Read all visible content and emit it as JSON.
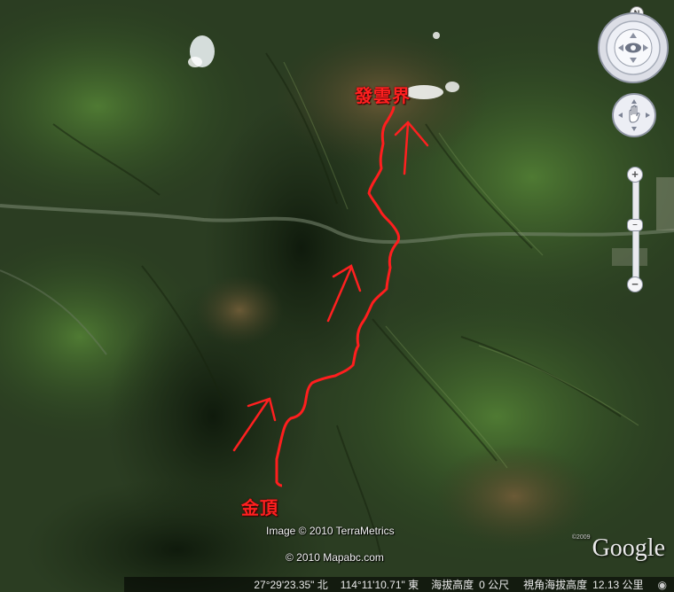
{
  "map": {
    "labels": {
      "summit_north": "發雲界",
      "summit_south": "金頂"
    },
    "credits": {
      "imagery": "Image © 2010 TerraMetrics",
      "data": "© 2010 Mapabc.com"
    },
    "logo": {
      "text": "Google",
      "year": "©2009"
    },
    "route_color": "#ff2020"
  },
  "statusbar": {
    "latitude": "27°29'23.35\" 北",
    "longitude": "114°11'10.71\" 東",
    "elevation_label": "海拔高度",
    "elevation_value": "0 公尺",
    "eye_alt_label": "視角海拔高度",
    "eye_alt_value": "12.13 公里"
  },
  "controls": {
    "north_letter": "N",
    "zoom_in": "+",
    "zoom_out": "−",
    "zoom_level": 0.45
  }
}
